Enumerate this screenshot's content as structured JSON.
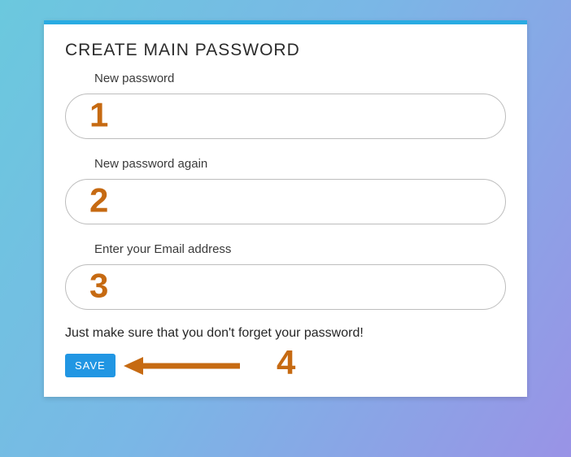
{
  "title": "CREATE MAIN PASSWORD",
  "fields": {
    "new_password": {
      "label": "New password",
      "value": "",
      "annotation": "1"
    },
    "new_password_again": {
      "label": "New password again",
      "value": "",
      "annotation": "2"
    },
    "email": {
      "label": "Enter your Email address",
      "value": "",
      "annotation": "3"
    }
  },
  "note": "Just make sure that you don't forget your password!",
  "save_label": "SAVE",
  "save_annotation": "4",
  "colors": {
    "accent": "#29abe2",
    "button": "#2196e3",
    "annotation": "#c66a12"
  }
}
